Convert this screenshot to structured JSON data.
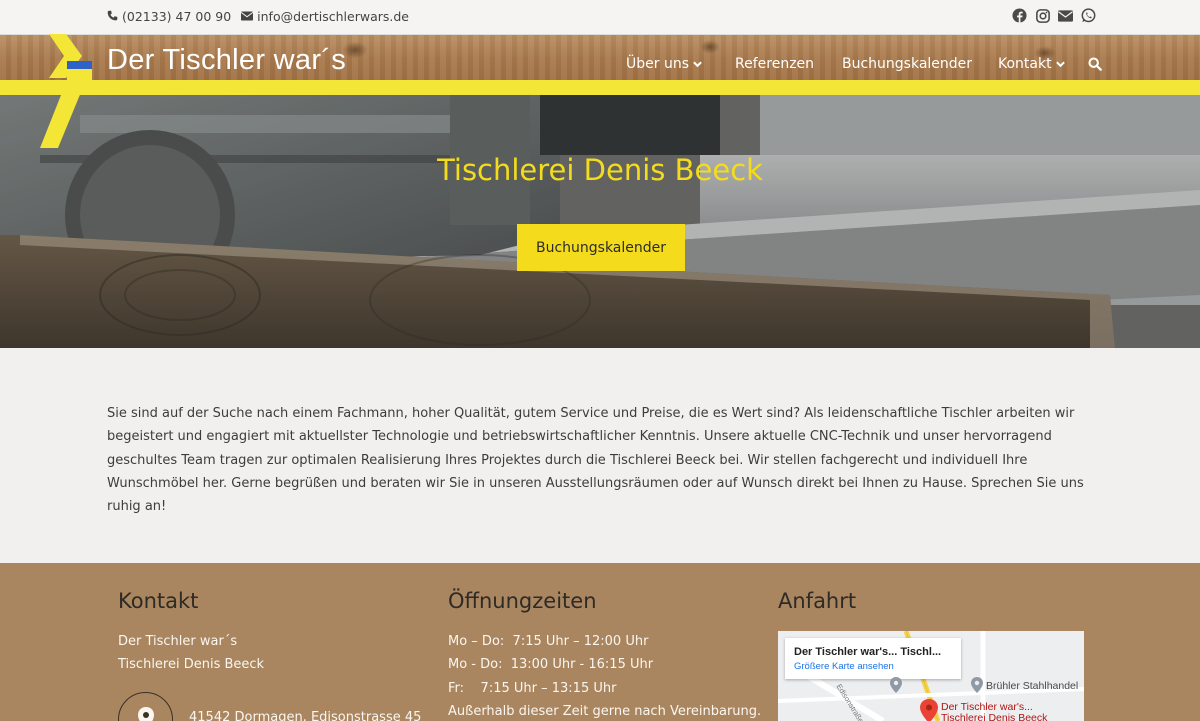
{
  "topbar": {
    "phone": "(02133) 47 00 90",
    "email": "info@dertischlerwars.de",
    "social_icons": [
      "facebook-icon",
      "instagram-icon",
      "envelope-icon",
      "whatsapp-icon"
    ]
  },
  "header": {
    "site_title": "Der Tischler war´s",
    "nav": [
      {
        "label": "Über uns",
        "has_dropdown": true
      },
      {
        "label": "Referenzen",
        "has_dropdown": false
      },
      {
        "label": "Buchungskalender",
        "has_dropdown": false
      },
      {
        "label": "Kontakt",
        "has_dropdown": true
      }
    ],
    "search_icon": "search-icon"
  },
  "hero": {
    "title": "Tischlerei Denis Beeck",
    "button_label": "Buchungskalender"
  },
  "intro": {
    "text": "Sie sind auf der Suche nach einem Fachmann, hoher Qualität, gutem Service und Preise, die es Wert sind? Als leidenschaftliche Tischler arbeiten wir begeistert und engagiert mit aktuellster Technologie und betriebswirtschaftlicher Kenntnis. Unsere aktuelle CNC-Technik und unser hervorragend geschultes Team tragen zur optimalen Realisierung Ihres Projektes durch die Tischlerei Beeck bei. Wir stellen fachgerecht und individuell Ihre Wunschmöbel her. Gerne begrüßen und beraten wir Sie in unseren Ausstellungsräumen oder auf Wunsch direkt bei Ihnen zu Hause. Sprechen Sie uns ruhig an!"
  },
  "footer": {
    "kontakt": {
      "heading": "Kontakt",
      "line1": "Der Tischler war´s",
      "line2": "Tischlerei Denis Beeck",
      "address": "41542 Dormagen, Edisonstrasse 45"
    },
    "hours": {
      "heading": "Öffnungzeiten",
      "lines": [
        "Mo – Do:  7:15 Uhr – 12:00 Uhr",
        "Mo - Do:  13:00 Uhr - 16:15 Uhr",
        "Fr:    7:15 Uhr – 13:15 Uhr",
        "Außerhalb dieser Zeit gerne nach Vereinbarung."
      ]
    },
    "anfahrt": {
      "heading": "Anfahrt",
      "map_card_title": "Der Tischler war's... Tischl...",
      "map_card_link": "Größere Karte ansehen",
      "poi_brühler": "Brühler Stahlhandel",
      "poi_marker_line1": "Der Tischler war's...",
      "poi_marker_line2": "Tischlerei Denis Beeck",
      "street_label": "Edisonstraße"
    }
  },
  "colors": {
    "accent_yellow": "#f4dc1c",
    "stripe_yellow": "#f4e637",
    "footer_brown": "#a9865f",
    "page_bg": "#f1f0ee"
  }
}
